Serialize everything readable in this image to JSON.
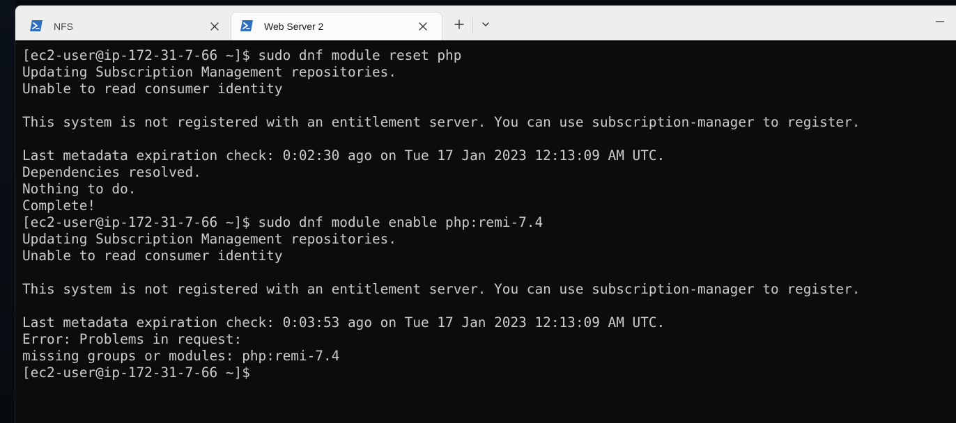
{
  "tabs": [
    {
      "title": "NFS",
      "active": false,
      "icon": "powershell-icon",
      "close_icon": "close-icon"
    },
    {
      "title": "Web Server 2",
      "active": true,
      "icon": "powershell-icon",
      "close_icon": "close-icon"
    }
  ],
  "titlebar": {
    "new_tab_icon": "plus-icon",
    "dropdown_icon": "chevron-down-icon",
    "minimize_icon": "minimize-icon"
  },
  "colors": {
    "terminal_bg": "#0c0c0c",
    "terminal_fg": "#cccccc",
    "titlebar_bg": "#eeeeee",
    "active_tab_bg": "#fbfbfb",
    "icon_accent": "#2f6fc2"
  },
  "terminal": {
    "lines": [
      "[ec2-user@ip-172-31-7-66 ~]$ sudo dnf module reset php",
      "Updating Subscription Management repositories.",
      "Unable to read consumer identity",
      "",
      "This system is not registered with an entitlement server. You can use subscription-manager to register.",
      "",
      "Last metadata expiration check: 0:02:30 ago on Tue 17 Jan 2023 12:13:09 AM UTC.",
      "Dependencies resolved.",
      "Nothing to do.",
      "Complete!",
      "[ec2-user@ip-172-31-7-66 ~]$ sudo dnf module enable php:remi-7.4",
      "Updating Subscription Management repositories.",
      "Unable to read consumer identity",
      "",
      "This system is not registered with an entitlement server. You can use subscription-manager to register.",
      "",
      "Last metadata expiration check: 0:03:53 ago on Tue 17 Jan 2023 12:13:09 AM UTC.",
      "Error: Problems in request:",
      "missing groups or modules: php:remi-7.4",
      "[ec2-user@ip-172-31-7-66 ~]$"
    ]
  }
}
